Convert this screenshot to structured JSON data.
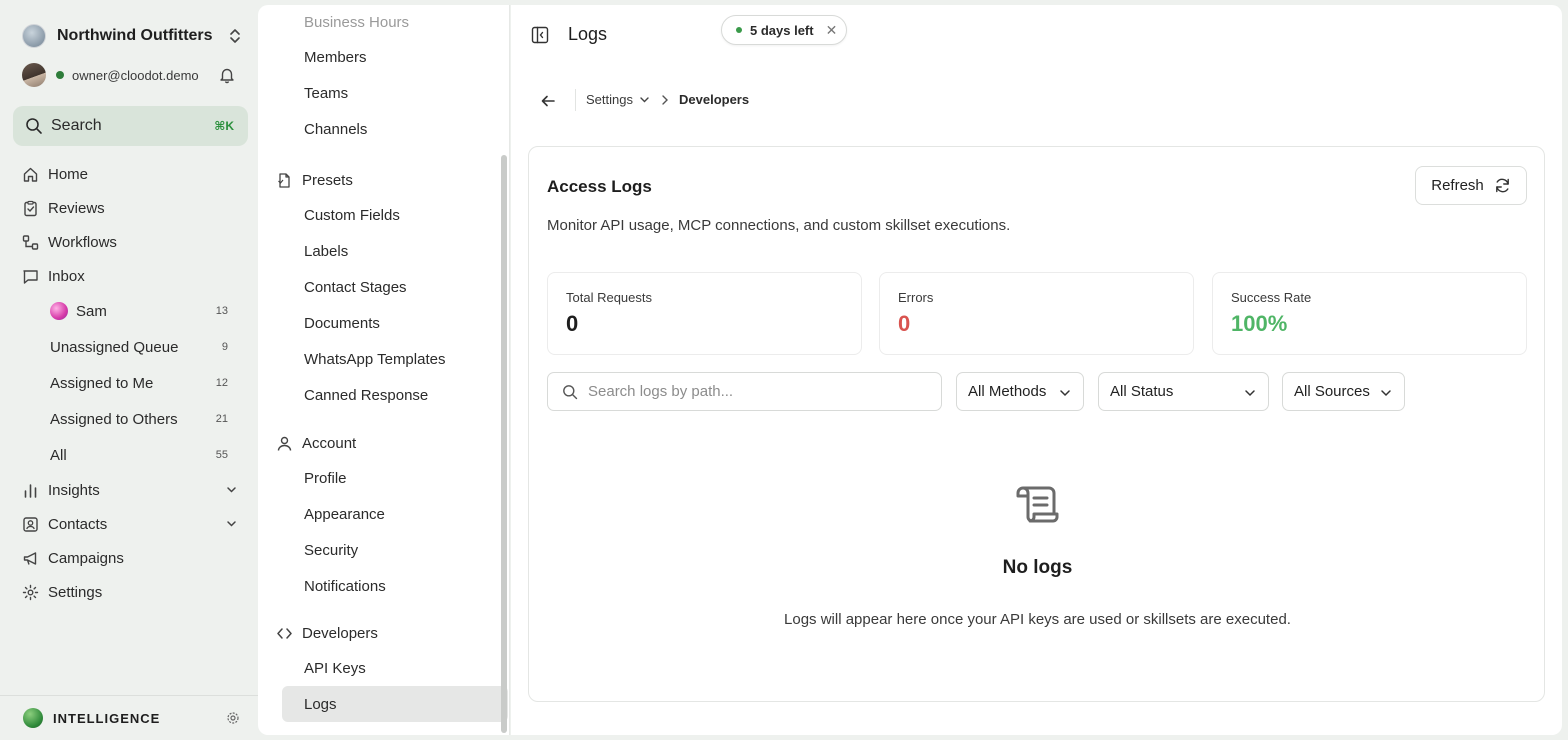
{
  "app": {
    "org_name": "Northwind Outfitters",
    "user_email": "owner@cloodot.demo",
    "search": {
      "label": "Search",
      "shortcut": "⌘K"
    },
    "nav": {
      "home": "Home",
      "reviews": "Reviews",
      "workflows": "Workflows",
      "inbox": "Inbox",
      "inbox_items": [
        {
          "label": "Sam",
          "count": "13"
        },
        {
          "label": "Unassigned Queue",
          "count": "9"
        },
        {
          "label": "Assigned to Me",
          "count": "12"
        },
        {
          "label": "Assigned to Others",
          "count": "21"
        },
        {
          "label": "All",
          "count": "55"
        }
      ],
      "insights": "Insights",
      "contacts": "Contacts",
      "campaigns": "Campaigns",
      "settings": "Settings"
    },
    "brand": "INTELLIGENCE"
  },
  "settings_nav": {
    "top_items": [
      "Business Hours",
      "Members",
      "Teams",
      "Channels"
    ],
    "presets": {
      "title": "Presets",
      "items": [
        "Custom Fields",
        "Labels",
        "Contact Stages",
        "Documents",
        "WhatsApp Templates",
        "Canned Response"
      ]
    },
    "account": {
      "title": "Account",
      "items": [
        "Profile",
        "Appearance",
        "Security",
        "Notifications"
      ]
    },
    "developers": {
      "title": "Developers",
      "items": [
        "API Keys",
        "Logs"
      ],
      "active": "Logs"
    }
  },
  "header": {
    "title": "Logs",
    "trial": "5 days left",
    "trial_close": "✕"
  },
  "breadcrumb": {
    "parent": "Settings",
    "current": "Developers"
  },
  "card": {
    "title": "Access Logs",
    "refresh_label": "Refresh",
    "description": "Monitor API usage, MCP connections, and custom skillset executions.",
    "stats": [
      {
        "label": "Total Requests",
        "value": "0"
      },
      {
        "label": "Errors",
        "value": "0"
      },
      {
        "label": "Success Rate",
        "value": "100%"
      }
    ],
    "search_placeholder": "Search logs by path...",
    "filters": {
      "methods": "All Methods",
      "status": "All Status",
      "sources": "All Sources"
    },
    "empty": {
      "title": "No logs",
      "subtitle": "Logs will appear here once your API keys are used or skillsets are executed."
    }
  },
  "colors": {
    "accent": "#2f8a3a",
    "error": "#d9534f",
    "success": "#4fb566",
    "sidebar_bg": "#eef1ee",
    "search_bg": "#d9e4da"
  }
}
